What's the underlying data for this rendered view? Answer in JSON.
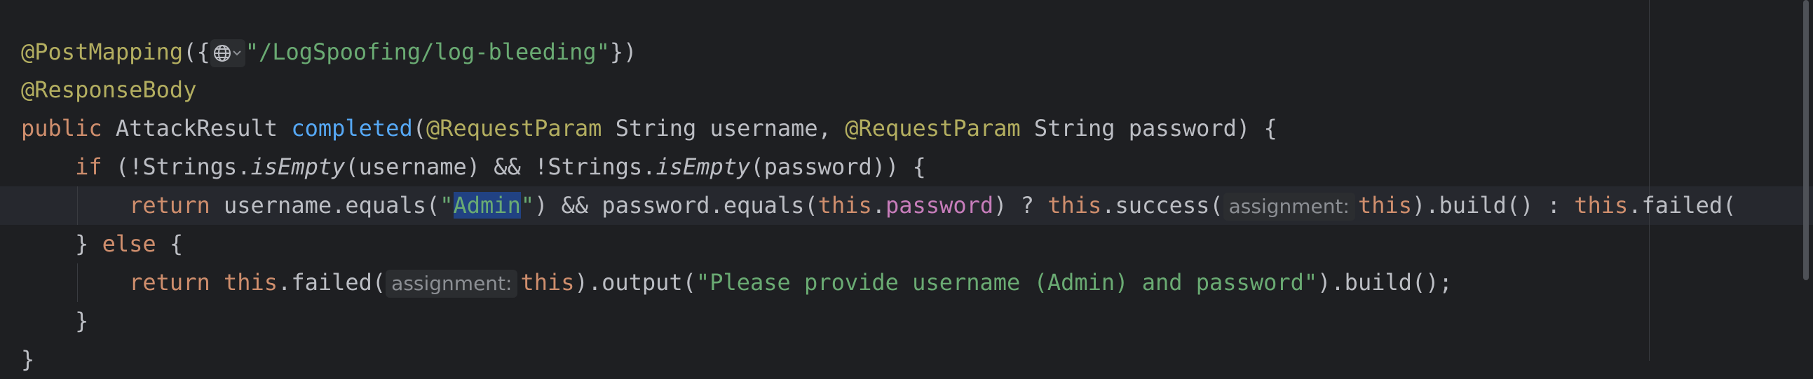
{
  "code": {
    "l1": {
      "annotation": "@PostMapping",
      "open": "({",
      "path": "\"/LogSpoofing/log-bleeding\"",
      "close": "})"
    },
    "l2": {
      "annotation": "@ResponseBody"
    },
    "l3": {
      "kw": "public",
      "type": " AttackResult ",
      "method": "completed",
      "open": "(",
      "ann1": "@RequestParam",
      "p1": " String username, ",
      "ann2": "@RequestParam",
      "p2": " String password) {"
    },
    "l4": {
      "kw": "if",
      "a": " (!Strings.",
      "m1": "isEmpty",
      "b": "(username) && !Strings.",
      "m2": "isEmpty",
      "c": "(password)) {"
    },
    "l5": {
      "kw": "return",
      "a": " username.equals(",
      "q1": "\"",
      "sel": "Admin",
      "q2": "\"",
      "b": ") && password.equals(",
      "this1": "this",
      "dot1": ".",
      "field": "password",
      "c": ") ? ",
      "this2": "this",
      "d": ".success(",
      "hint": "assignment:",
      "this3": "this",
      "e": ").build() : ",
      "this4": "this",
      "f": ".failed("
    },
    "l6": {
      "close": "} ",
      "kw": "else",
      "open": " {"
    },
    "l7": {
      "kw": "return",
      "this1": "this",
      "a": ".failed(",
      "hint": "assignment:",
      "this2": "this",
      "b": ").output(",
      "str": "\"Please provide username (Admin) and password\"",
      "c": ").build();"
    },
    "l8": {
      "close": "}"
    },
    "l9": {
      "close": "}"
    }
  },
  "icons": {
    "url_hint": "globe-icon",
    "url_hint_menu": "chevron-down-icon"
  },
  "colors": {
    "background": "#1e1f22",
    "keyword": "#cf8e6d",
    "annotation": "#b3ae60",
    "method": "#56a8f5",
    "string": "#6aab73",
    "field": "#c77dbb",
    "selection": "#214283"
  }
}
